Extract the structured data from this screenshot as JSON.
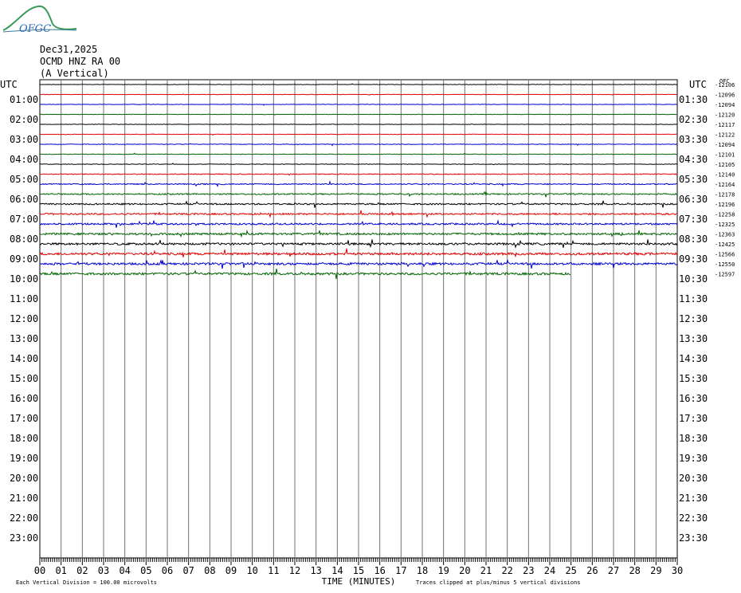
{
  "logo_text": "OFGC",
  "header": {
    "date": "Dec31,2025",
    "station": "OCMD HNZ RA 00",
    "component": "(A Vertical)"
  },
  "colors": {
    "trace_cycle": [
      "#000000",
      "#e00000",
      "#0000d0",
      "#006400"
    ],
    "grid": "#808080",
    "logo": "#3a9a5a"
  },
  "chart_data": {
    "type": "line",
    "title": "Dec31,2025",
    "subtitle": "OCMD HNZ RA 00 (A Vertical)",
    "xlabel": "TIME (MINUTES)",
    "ylabel": "UTC",
    "right_axis_label": "UTC",
    "xlim": [
      0,
      30
    ],
    "x_ticks": [
      "00",
      "01",
      "02",
      "03",
      "04",
      "05",
      "06",
      "07",
      "08",
      "09",
      "10",
      "11",
      "12",
      "13",
      "14",
      "15",
      "16",
      "17",
      "18",
      "19",
      "20",
      "21",
      "22",
      "23",
      "24",
      "25",
      "26",
      "27",
      "28",
      "29",
      "30"
    ],
    "left_hour_labels": [
      "01:00",
      "02:00",
      "03:00",
      "04:00",
      "05:00",
      "06:00",
      "07:00",
      "08:00",
      "09:00",
      "10:00",
      "11:00",
      "12:00",
      "13:00",
      "14:00",
      "15:00",
      "16:00",
      "17:00",
      "18:00",
      "19:00",
      "20:00",
      "21:00",
      "22:00",
      "23:00"
    ],
    "right_hour_labels": [
      "01:30",
      "02:30",
      "03:30",
      "04:30",
      "05:30",
      "06:30",
      "07:30",
      "08:30",
      "09:30",
      "10:30",
      "11:30",
      "12:30",
      "13:30",
      "14:30",
      "15:30",
      "16:30",
      "17:30",
      "18:30",
      "19:30",
      "20:30",
      "21:30",
      "22:30",
      "23:30"
    ],
    "trace_offsets": [
      -12106,
      -12096,
      -12094,
      -12120,
      -12117,
      -12122,
      -12094,
      -12101,
      -12105,
      -12140,
      -12164,
      -12178,
      -12196,
      -12258,
      -12325,
      -12363,
      -12425,
      -12566,
      -12550,
      -12597
    ],
    "trace_activity": [
      0.15,
      0.15,
      0.15,
      0.15,
      0.15,
      0.15,
      0.2,
      0.2,
      0.2,
      0.35,
      0.45,
      0.55,
      0.6,
      0.65,
      0.7,
      0.8,
      0.85,
      0.95,
      0.9,
      0.9
    ],
    "last_trace_end_minute": 25,
    "top_right_label": "OFC",
    "footer_left": "Each Vertical Division =  100.00 microvolts",
    "footer_right": "Traces clipped at plus/minus 5 vertical divisions",
    "grid": true
  }
}
